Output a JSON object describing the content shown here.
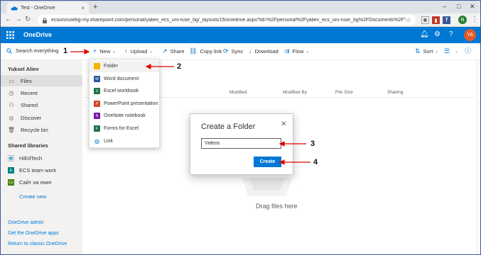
{
  "browser": {
    "tab_title": "Test - OneDrive",
    "tab_close": "×",
    "new_tab": "+",
    "url": "ecsunirusebg-my.sharepoint.com/personal/yaliev_ecs_uni-ruse_bg/_layouts/15/onedrive.aspx?id=%2Fpersonal%2Fyaliev_ecs_uni-ruse_bg%2FDocuments%2FTest",
    "profile_initial": "N",
    "window_controls": [
      "–",
      "□",
      "✕"
    ]
  },
  "suitebar": {
    "app_title": "OneDrive",
    "user_initials": "YA"
  },
  "commandbar": {
    "search_placeholder": "Search everything",
    "new_label": "New",
    "upload_label": "Upload",
    "share_label": "Share",
    "copylink_label": "Copy link",
    "sync_label": "Sync",
    "download_label": "Download",
    "flow_label": "Flow",
    "sort_label": "Sort"
  },
  "sidebar": {
    "user_name": "Yuksel Aliev",
    "items": [
      {
        "label": "Files",
        "icon": "folder-icon"
      },
      {
        "label": "Recent",
        "icon": "clock-icon"
      },
      {
        "label": "Shared",
        "icon": "people-icon"
      },
      {
        "label": "Discover",
        "icon": "compass-icon"
      },
      {
        "label": "Recycle bin",
        "icon": "recycle-bin-icon"
      }
    ],
    "shared_libraries_heading": "Shared libraries",
    "libraries": [
      {
        "label": "HiEdTech",
        "color": "#ffffff",
        "badge": ""
      },
      {
        "label": "ECS team work",
        "color": "#038387",
        "badge": "E"
      },
      {
        "label": "Сайт на екип",
        "color": "#498205",
        "badge": "Се"
      }
    ],
    "create_new": "Create new",
    "footer_links": [
      "OneDrive admin",
      "Get the OneDrive apps",
      "Return to classic OneDrive"
    ]
  },
  "main": {
    "columns": [
      "Modified",
      "Modified By",
      "File Size",
      "Sharing"
    ],
    "drag_text": "Drag files here"
  },
  "new_menu": {
    "items": [
      {
        "label": "Folder",
        "color": "#f4b400"
      },
      {
        "label": "Word document",
        "color": "#2b579a"
      },
      {
        "label": "Excel workbook",
        "color": "#217346"
      },
      {
        "label": "PowerPoint presentation",
        "color": "#d24726"
      },
      {
        "label": "OneNote notebook",
        "color": "#7719aa"
      },
      {
        "label": "Forms for Excel",
        "color": "#217346"
      },
      {
        "label": "Link",
        "color": "#0078d4"
      }
    ]
  },
  "dialog": {
    "title": "Create a Folder",
    "close": "✕",
    "folder_name_value": "Videos",
    "create_label": "Create"
  },
  "annotations": [
    "1",
    "2",
    "3",
    "4"
  ],
  "colors": {
    "suite_blue": "#0078d4",
    "arrow_red": "#e00000",
    "avatar_orange": "#e05a2b"
  }
}
